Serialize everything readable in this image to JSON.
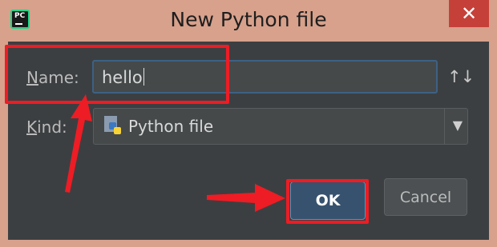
{
  "window": {
    "title": "New Python file",
    "app_icon_text": "PC",
    "close_glyph": "✕"
  },
  "form": {
    "name_label_accel": "N",
    "name_label_rest": "ame:",
    "name_value": "hello",
    "sort_glyph": "↑↓",
    "kind_label_accel": "K",
    "kind_label_rest": "ind:",
    "kind_value": "Python file",
    "dropdown_glyph": "▼"
  },
  "buttons": {
    "ok_label": "OK",
    "cancel_label": "Cancel"
  },
  "icons": {
    "app": "pycharm-app-icon",
    "python_file": "python-file-icon",
    "sort": "sort-icon",
    "dropdown": "chevron-down-icon",
    "close": "close-icon"
  },
  "colors": {
    "highlight": "#ee1c24",
    "dialog_bg": "#3c3f41",
    "frame": "#d7a18c",
    "close_btn": "#c6403a"
  }
}
